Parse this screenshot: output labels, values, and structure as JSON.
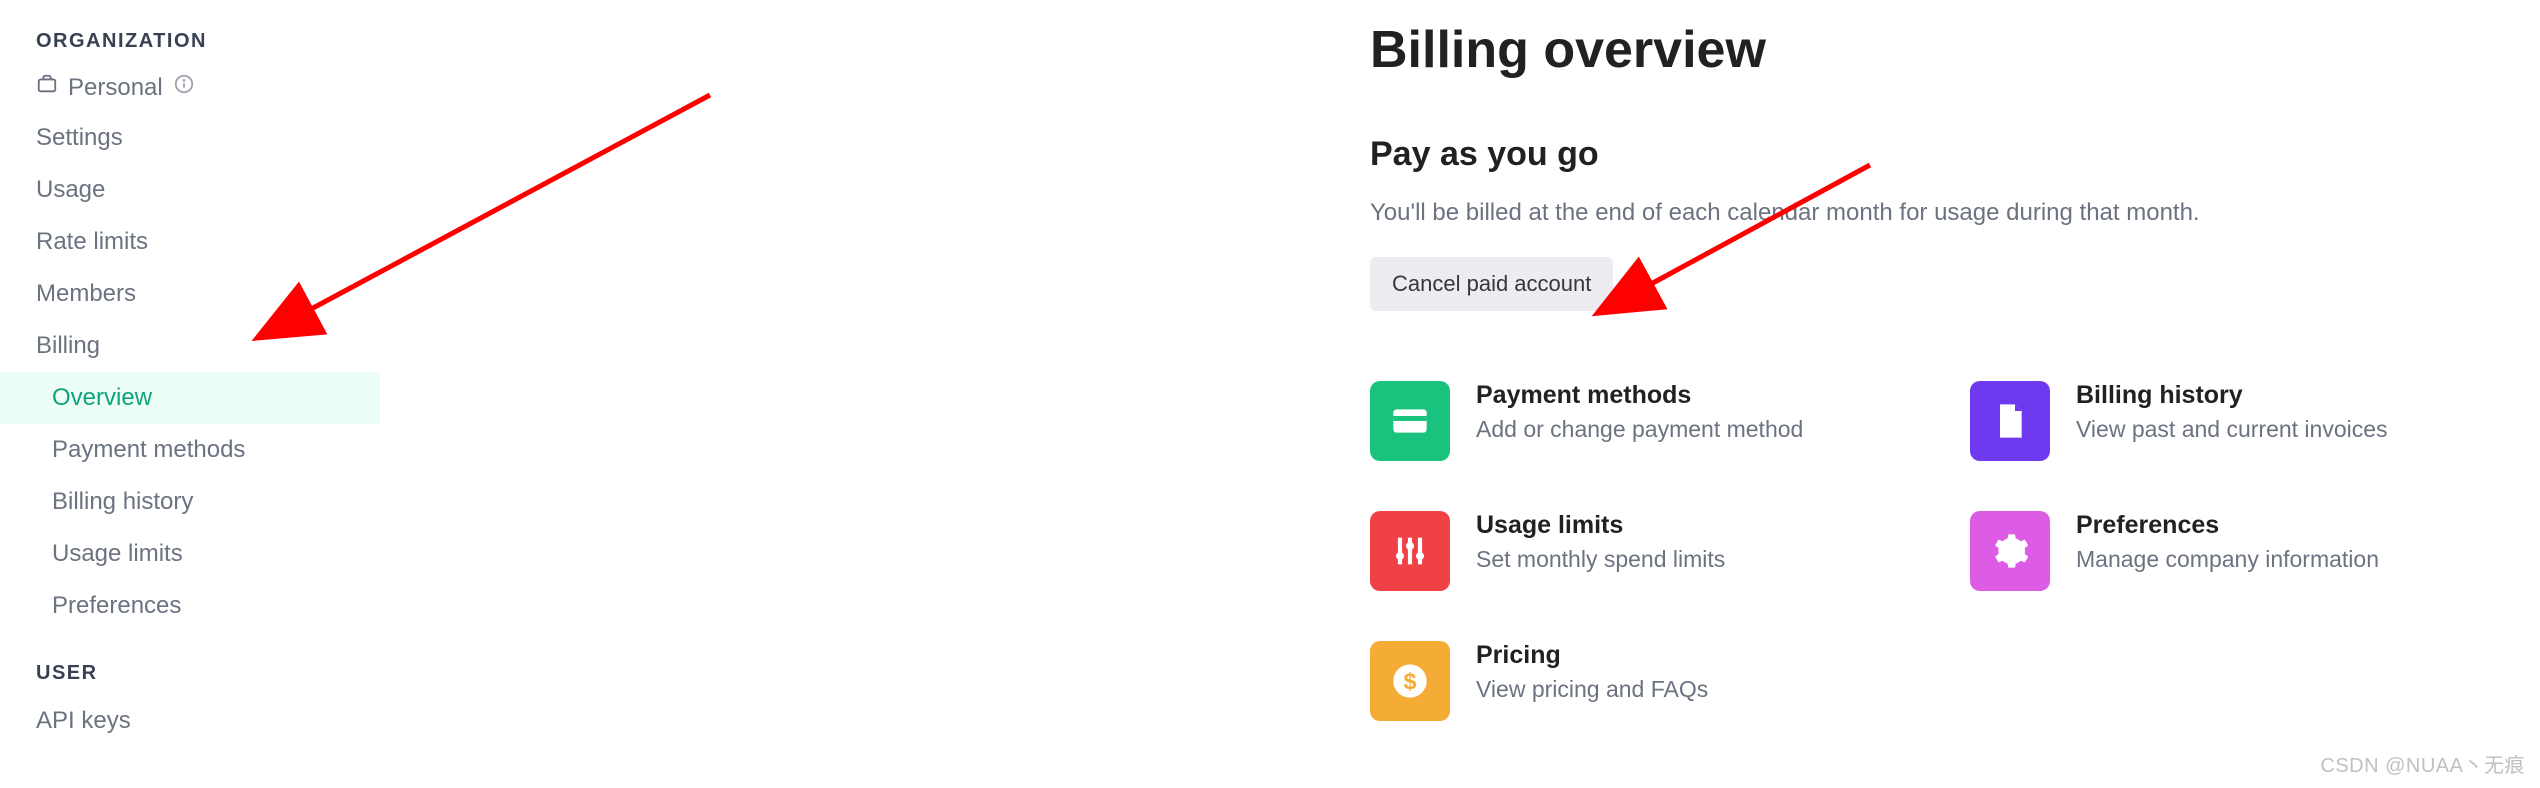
{
  "sidebar": {
    "org_header": "ORGANIZATION",
    "org_name": "Personal",
    "items": [
      {
        "label": "Settings"
      },
      {
        "label": "Usage"
      },
      {
        "label": "Rate limits"
      },
      {
        "label": "Members"
      },
      {
        "label": "Billing"
      }
    ],
    "billing_sub": [
      {
        "label": "Overview",
        "active": true
      },
      {
        "label": "Payment methods"
      },
      {
        "label": "Billing history"
      },
      {
        "label": "Usage limits"
      },
      {
        "label": "Preferences"
      }
    ],
    "user_header": "USER",
    "user_items": [
      {
        "label": "API keys"
      }
    ]
  },
  "main": {
    "title": "Billing overview",
    "section_title": "Pay as you go",
    "section_desc": "You'll be billed at the end of each calendar month for usage during that month.",
    "cancel_btn": "Cancel paid account",
    "cards": [
      {
        "title": "Payment methods",
        "desc": "Add or change payment method",
        "icon": "card-icon",
        "color": "green"
      },
      {
        "title": "Billing history",
        "desc": "View past and current invoices",
        "icon": "document-icon",
        "color": "purple"
      },
      {
        "title": "Usage limits",
        "desc": "Set monthly spend limits",
        "icon": "sliders-icon",
        "color": "red"
      },
      {
        "title": "Preferences",
        "desc": "Manage company information",
        "icon": "gear-icon",
        "color": "magenta"
      },
      {
        "title": "Pricing",
        "desc": "View pricing and FAQs",
        "icon": "dollar-icon",
        "color": "orange"
      }
    ]
  },
  "watermark": "CSDN @NUAA丶无痕"
}
